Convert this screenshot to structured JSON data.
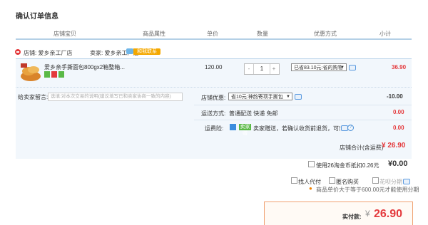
{
  "page": {
    "title": "确认订单信息"
  },
  "columns": [
    "店铺宝贝",
    "商品属性",
    "单价",
    "数量",
    "优惠方式",
    "小计"
  ],
  "shop": {
    "shop_label": "店铺: 爱乡亲工厂店",
    "seller_label": "卖家: 爱乡亲工厂店",
    "contact_label": "和我联系"
  },
  "item": {
    "name": "爱乡亲手撕面包800gx2箱整箱...",
    "price": "120.00",
    "qty_minus": "-",
    "qty": "1",
    "qty_plus": "+",
    "discount_option": "已省83.10元:省的购物",
    "subtotal": "36.90"
  },
  "options": {
    "message_label": "给卖家留言:",
    "message_placeholder": "选填:对本次交易的说明(建议填写已和卖家协商一致的内容)",
    "shop_discount_label": "店铺优惠:",
    "shop_discount_option": "省10元:神韵寄项手撕包",
    "shop_discount_value": "-10.00",
    "shipping_label": "运送方式:",
    "shipping_value": "普通配送 快递 免邮",
    "shipping_price": "0.00",
    "insurance_label": "运费险:",
    "insurance_badge": "卖家赠",
    "insurance_text": "卖家赠送，若确认收货前退货，可获得...",
    "insurance_price": "0.00",
    "store_total_label": "店铺合计(含运费)",
    "store_total_value": "¥ 26.90"
  },
  "summary": {
    "coins_label": "使用26淘金币抵扣0.26元",
    "coins_value": "¥0.00",
    "proxy_pay": "找人代付",
    "anonymous": "匿名购买",
    "installment": "花呗分期",
    "installment_note": "商品单价大于等于600.00元才能使用分期",
    "payable_label": "实付款:",
    "payable_yen": "¥",
    "payable_value": "26.90"
  },
  "colors": {
    "accent_red": "#e4393c",
    "header_line": "#b4d0e6",
    "row_bg": "#f2f7fc"
  },
  "icons": [
    "shop-icon",
    "wangwang-icon",
    "chat-icon",
    "help-icon",
    "location-pin-icon"
  ]
}
